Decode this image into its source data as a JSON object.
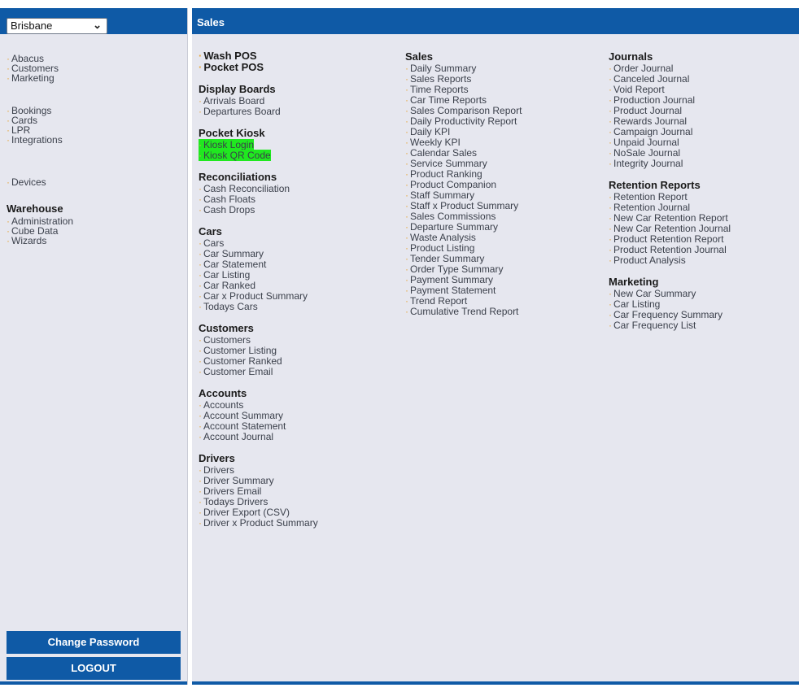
{
  "sidebar": {
    "location": "Brisbane",
    "group1": [
      "Abacus",
      "Customers",
      "Marketing"
    ],
    "group2": [
      "Bookings",
      "Cards",
      "LPR",
      "Integrations"
    ],
    "group3": [
      "Devices"
    ],
    "warehouse_heading": "Warehouse",
    "warehouse": [
      "Administration",
      "Cube Data",
      "Wizards"
    ],
    "change_password": "Change Password",
    "logout": "LOGOUT"
  },
  "main": {
    "header": "Sales",
    "col1": [
      {
        "title": "",
        "items": [
          "Wash POS",
          "Pocket POS"
        ],
        "bold_items": true
      },
      {
        "title": "Display Boards",
        "items": [
          "Arrivals Board",
          "Departures Board"
        ]
      },
      {
        "title": "Pocket Kiosk",
        "items": [
          "Kiosk Login",
          "Kiosk QR Code"
        ],
        "highlighted": true
      },
      {
        "title": "Reconciliations",
        "items": [
          "Cash Reconciliation",
          "Cash Floats",
          "Cash Drops"
        ]
      },
      {
        "title": "Cars",
        "items": [
          "Cars",
          "Car Summary",
          "Car Statement",
          "Car Listing",
          "Car Ranked",
          "Car x Product Summary",
          "Todays Cars"
        ]
      },
      {
        "title": "Customers",
        "items": [
          "Customers",
          "Customer Listing",
          "Customer Ranked",
          "Customer Email"
        ]
      },
      {
        "title": "Accounts",
        "items": [
          "Accounts",
          "Account Summary",
          "Account Statement",
          "Account Journal"
        ]
      },
      {
        "title": "Drivers",
        "items": [
          "Drivers",
          "Driver Summary",
          "Drivers Email",
          "Todays Drivers",
          "Driver Export (CSV)",
          "Driver x Product Summary"
        ]
      }
    ],
    "col2": [
      {
        "title": "Sales",
        "items": [
          "Daily Summary",
          "Sales Reports",
          "Time Reports",
          "Car Time Reports",
          "Sales Comparison Report",
          "Daily Productivity Report",
          "Daily KPI",
          "Weekly KPI",
          "Calendar Sales",
          "Service Summary",
          "Product Ranking",
          "Product Companion",
          "Staff Summary",
          "Staff x Product Summary",
          "Sales Commissions",
          "Departure Summary",
          "Waste Analysis",
          "Product Listing",
          "Tender Summary",
          "Order Type Summary",
          "Payment Summary",
          "Payment Statement",
          "Trend Report",
          "Cumulative Trend Report"
        ]
      }
    ],
    "col3": [
      {
        "title": "Journals",
        "items": [
          "Order Journal",
          "Canceled Journal",
          "Void Report",
          "Production Journal",
          "Product Journal",
          "Rewards Journal",
          "Campaign Journal",
          "Unpaid Journal",
          "NoSale Journal",
          "Integrity Journal"
        ]
      },
      {
        "title": "Retention Reports",
        "items": [
          "Retention Report",
          "Retention Journal",
          "New Car Retention Report",
          "New Car Retention Journal",
          "Product Retention Report",
          "Product Retention Journal",
          "Product Analysis"
        ]
      },
      {
        "title": "Marketing",
        "items": [
          "New Car Summary",
          "Car Listing",
          "Car Frequency Summary",
          "Car Frequency List"
        ]
      }
    ]
  },
  "colors": {
    "accent": "#0f5aa6",
    "panel": "#e6e7ef",
    "bullet": "#e7a63b",
    "highlight": "#20e820"
  },
  "icons": {
    "location_dropdown": "chevron-down-icon",
    "bullet": "bullet-dot-icon"
  }
}
